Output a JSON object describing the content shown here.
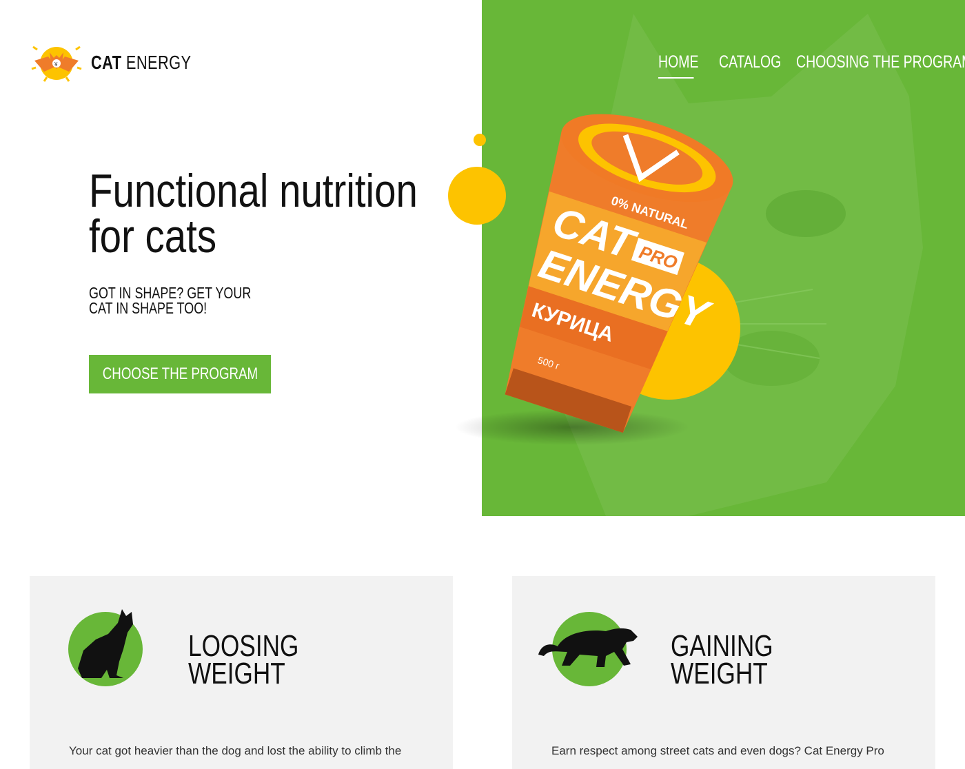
{
  "brand": {
    "name_bold": "CAT",
    "name_regular": "ENERGY"
  },
  "nav": [
    {
      "label": "HOME",
      "active": true
    },
    {
      "label": "CATALOG",
      "active": false
    },
    {
      "label": "CHOOSING THE PROGRAM",
      "active": false
    }
  ],
  "hero": {
    "title_line1": "Functional nutrition",
    "title_line2": "for cats",
    "subtitle": "GOT IN SHAPE? GET YOUR CAT IN SHAPE TOO!",
    "cta_label": "CHOOSE THE PROGRAM"
  },
  "product": {
    "tagline": "0% NATURAL",
    "brand_line1": "CAT",
    "badge": "PRO",
    "brand_line2": "ENERGY",
    "flavor": "КУРИЦА",
    "weight": "500 г"
  },
  "programs": [
    {
      "title_line1": "LOOSING",
      "title_line2": "WEIGHT",
      "text": "Your cat got heavier than the dog and lost the ability to climb the",
      "icon": "sitting-cat-icon"
    },
    {
      "title_line1": "GAINING",
      "title_line2": "WEIGHT",
      "text": "Earn respect among street cats and even dogs? Cat Energy Pro",
      "icon": "panther-icon"
    }
  ],
  "colors": {
    "accent": "#68b738",
    "yellow": "#fdc300",
    "orange": "#ef7c2a",
    "card": "#f2f2f2"
  }
}
